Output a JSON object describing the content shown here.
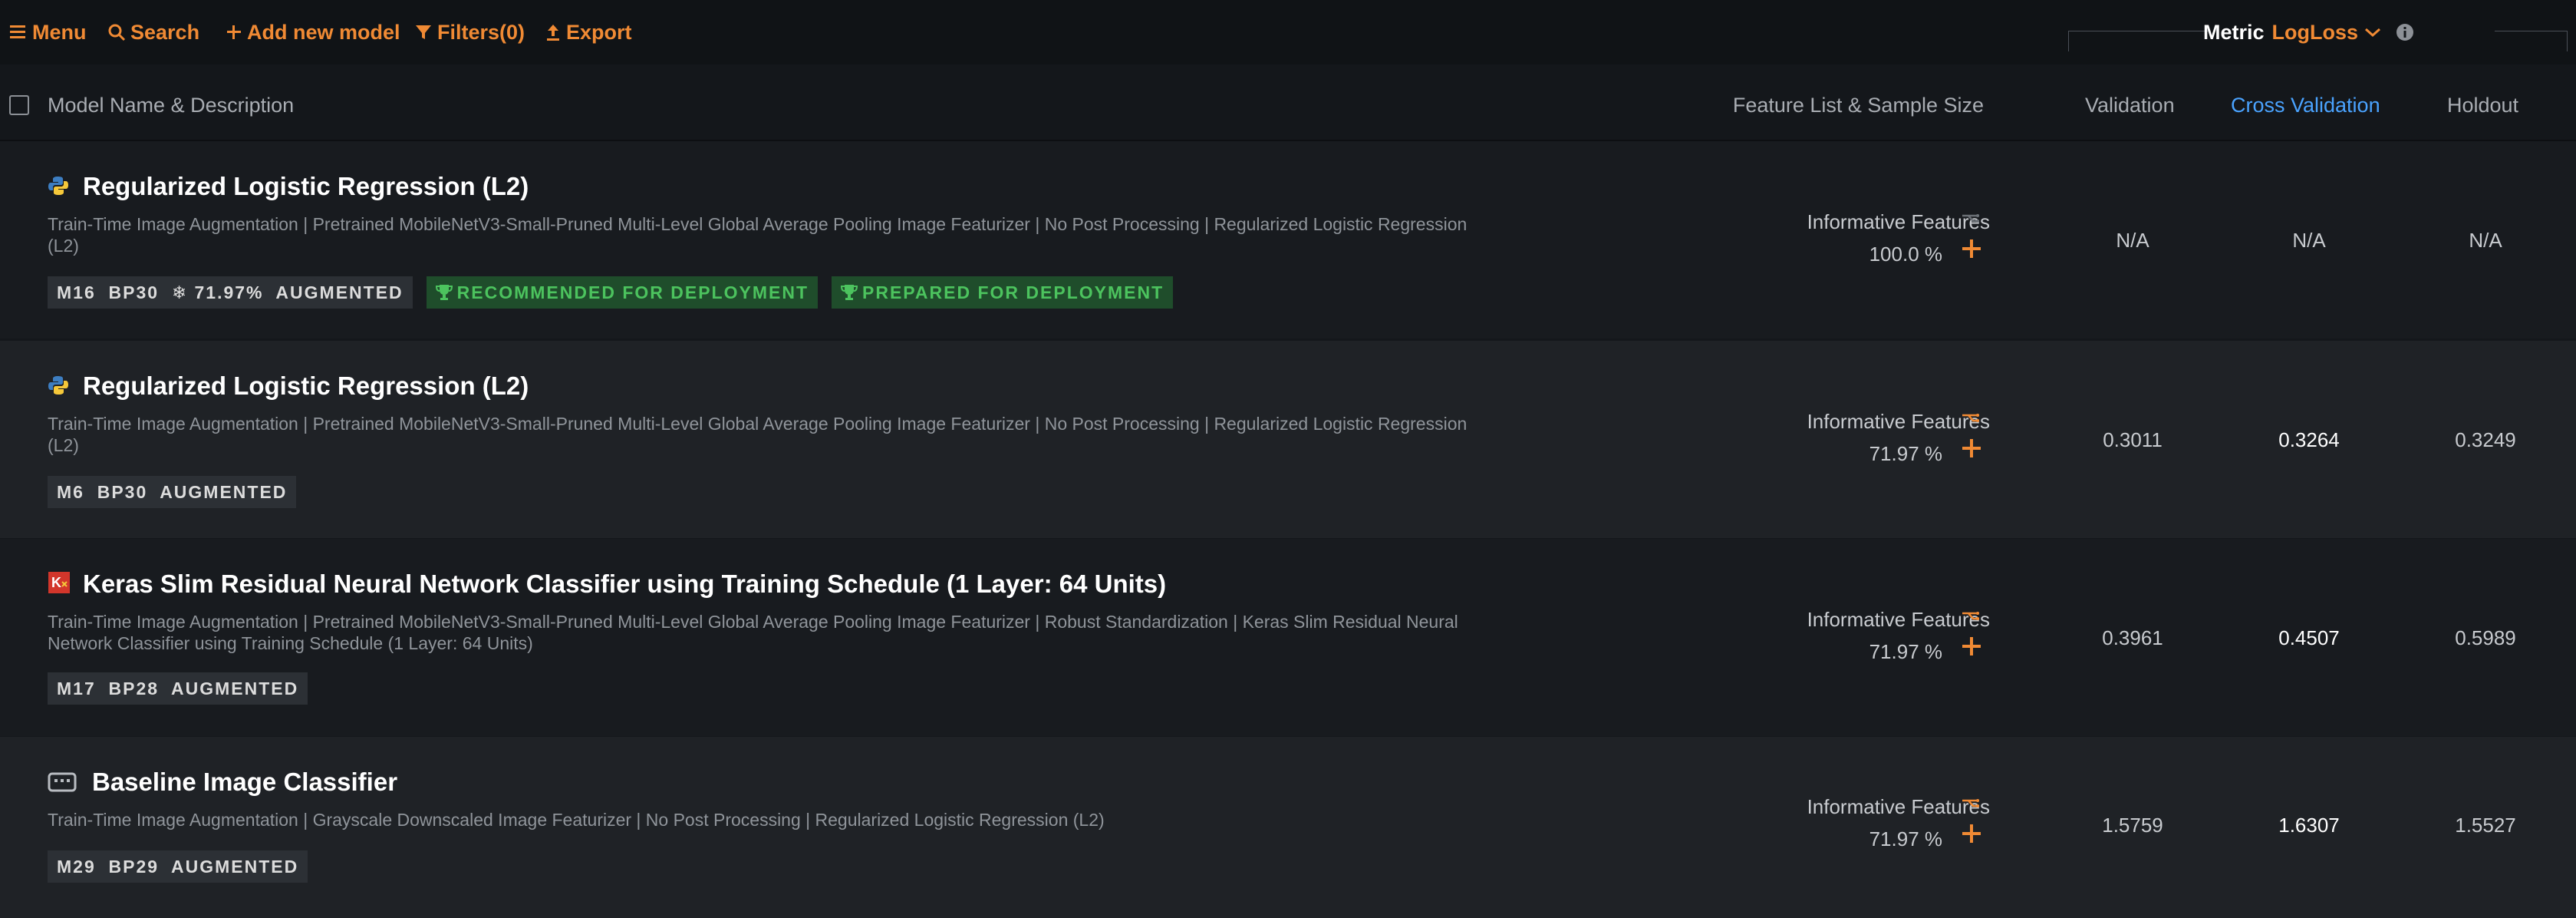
{
  "toolbar": {
    "menu": "Menu",
    "search": "Search",
    "add_model": "Add new model",
    "filters": "Filters(0)",
    "export": "Export",
    "metric_label": "Metric",
    "metric_value": "LogLoss"
  },
  "columns": {
    "model": "Model Name & Description",
    "feature_list": "Feature List & Sample Size",
    "validation": "Validation",
    "cross_validation": "Cross Validation",
    "holdout": "Holdout"
  },
  "colors": {
    "accent": "#f08a34",
    "active_column": "#4aa3ff",
    "deployment_badge": "#4cc35e"
  },
  "rows": [
    {
      "icon": "python-icon",
      "title": "Regularized Logistic Regression (L2)",
      "description": "Train-Time Image Augmentation | Pretrained MobileNetV3-Small-Pruned Multi-Level Global Average Pooling Image Featurizer | No Post Processing | Regularized Logistic Regression (L2)",
      "tag_main": "M16  BP30  ❄ 71.97%  AUGMENTED",
      "badge_recommended": "RECOMMENDED FOR DEPLOYMENT",
      "badge_prepared": "PREPARED FOR DEPLOYMENT",
      "feature_list": "Informative Features",
      "sample_size": "100.0 %",
      "validation": "N/A",
      "cross_validation": "N/A",
      "holdout": "N/A"
    },
    {
      "icon": "python-icon",
      "title": "Regularized Logistic Regression (L2)",
      "description": "Train-Time Image Augmentation | Pretrained MobileNetV3-Small-Pruned Multi-Level Global Average Pooling Image Featurizer | No Post Processing | Regularized Logistic Regression (L2)",
      "tag_main": "M6  BP30  AUGMENTED",
      "feature_list": "Informative Features",
      "sample_size": "71.97 %",
      "validation": "0.3011",
      "cross_validation": "0.3264",
      "holdout": "0.3249"
    },
    {
      "icon": "keras-icon",
      "title": "Keras Slim Residual Neural Network Classifier using Training Schedule (1 Layer: 64 Units)",
      "description": "Train-Time Image Augmentation | Pretrained MobileNetV3-Small-Pruned Multi-Level Global Average Pooling Image Featurizer | Robust Standardization | Keras Slim Residual Neural Network Classifier using Training Schedule (1 Layer: 64 Units)",
      "tag_main": "M17  BP28  AUGMENTED",
      "feature_list": "Informative Features",
      "sample_size": "71.97 %",
      "validation": "0.3961",
      "cross_validation": "0.4507",
      "holdout": "0.5989"
    },
    {
      "icon": "image-classifier-icon",
      "title": "Baseline Image Classifier",
      "description": "Train-Time Image Augmentation | Grayscale Downscaled Image Featurizer | No Post Processing | Regularized Logistic Regression (L2)",
      "tag_main": "M29  BP29  AUGMENTED",
      "feature_list": "Informative Features",
      "sample_size": "71.97 %",
      "validation": "1.5759",
      "cross_validation": "1.6307",
      "holdout": "1.5527"
    }
  ]
}
